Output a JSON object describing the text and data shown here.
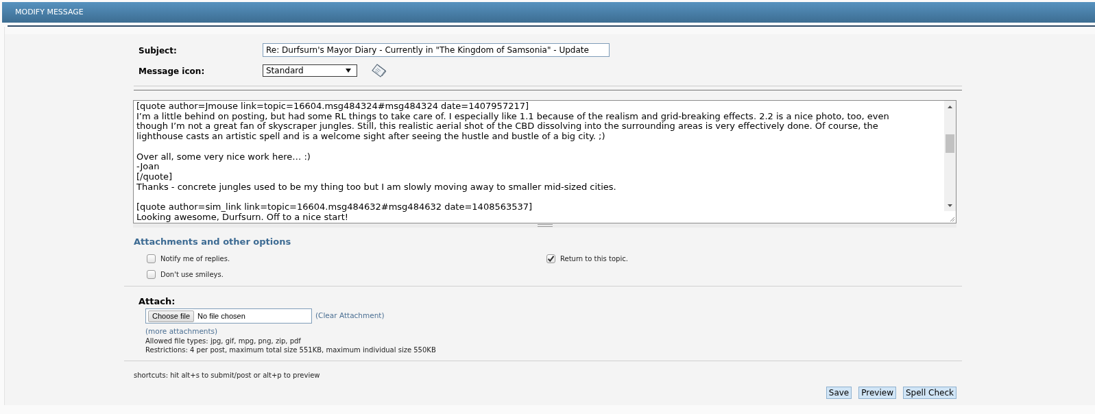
{
  "header": {
    "title": "MODIFY MESSAGE"
  },
  "subject": {
    "label": "Subject:",
    "value": "Re: Durfsurn's Mayor Diary - Currently in \"The Kingdom of Samsonia\" - Update"
  },
  "message_icon": {
    "label": "Message icon:",
    "value": "Standard"
  },
  "message": {
    "blocks": [
      {
        "lines": [
          "[quote author=Jmouse link=topic=16604.msg484324#msg484324 date=1407957217]",
          "I’m a little behind on posting, but had some RL things to take care of. I especially like 1.1 because of the realism and grid-breaking effects. 2.2 is a nice photo, too, even",
          "though I’m not a great fan of skyscraper jungles. Still, this realistic aerial shot of the CBD dissolving into the surrounding areas is very effectively done. Of course, the",
          "lighthouse casts an artistic spell and is a welcome sight after seeing the hustle and bustle of a big city. ;)"
        ]
      },
      {
        "lines": [
          "Over all, some very nice work here… :)",
          "-Joan",
          "[/quote]",
          "Thanks - concrete jungles used to be my thing too but I am slowly moving away to smaller mid-sized cities."
        ]
      },
      {
        "lines": [
          "[quote author=sim_link link=topic=16604.msg484632#msg484632 date=1408563537]",
          "Looking awesome, Durfsurn. Off to a nice start!"
        ]
      }
    ]
  },
  "options": {
    "title": "Attachments and other options",
    "items": [
      {
        "label": "Notify me of replies.",
        "checked": false
      },
      {
        "label": "Return to this topic.",
        "checked": true
      },
      {
        "label": "Don't use smileys.",
        "checked": false
      }
    ]
  },
  "attach": {
    "label": "Attach:",
    "button": "Choose file",
    "status": "No file chosen",
    "clear_link": "(Clear Attachment)",
    "more_link": "(more attachments)",
    "allowed": "Allowed file types: jpg, gif, mpg, png, zip, pdf",
    "restrictions": "Restrictions: 4 per post, maximum total size 551KB, maximum individual size 550KB"
  },
  "shortcuts": "shortcuts: hit alt+s to submit/post or alt+p to preview",
  "buttons": [
    "Save",
    "Preview",
    "Spell Check"
  ]
}
